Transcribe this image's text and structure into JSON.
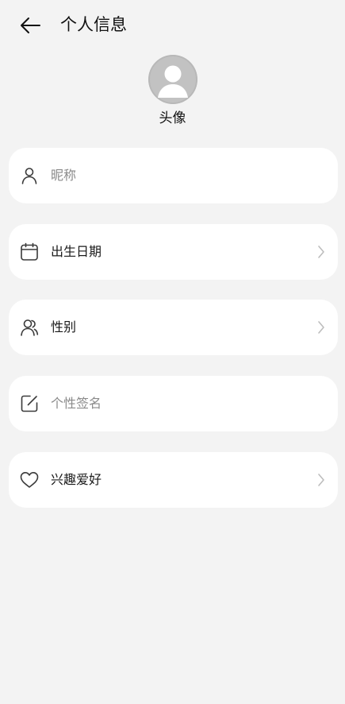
{
  "header": {
    "title": "个人信息",
    "back_icon": "arrow-left-icon"
  },
  "avatar": {
    "label": "头像",
    "icon": "default-avatar-icon",
    "background": "#c2c2c2"
  },
  "fields": [
    {
      "key": "nickname",
      "label": "昵称",
      "icon": "user-icon",
      "is_placeholder": true,
      "has_chevron": false
    },
    {
      "key": "birthday",
      "label": "出生日期",
      "icon": "calendar-icon",
      "is_placeholder": false,
      "has_chevron": true
    },
    {
      "key": "gender",
      "label": "性别",
      "icon": "users-icon",
      "is_placeholder": false,
      "has_chevron": true
    },
    {
      "key": "signature",
      "label": "个性签名",
      "icon": "edit-icon",
      "is_placeholder": true,
      "has_chevron": false
    },
    {
      "key": "hobbies",
      "label": "兴趣爱好",
      "icon": "heart-icon",
      "is_placeholder": false,
      "has_chevron": true
    }
  ],
  "colors": {
    "page_background": "#f3f3f3",
    "card_background": "#ffffff",
    "text_primary": "#1a1a1a",
    "text_placeholder": "#8a8a8a",
    "icon_stroke": "#3a3a3a",
    "chevron": "#bdbdbd"
  }
}
